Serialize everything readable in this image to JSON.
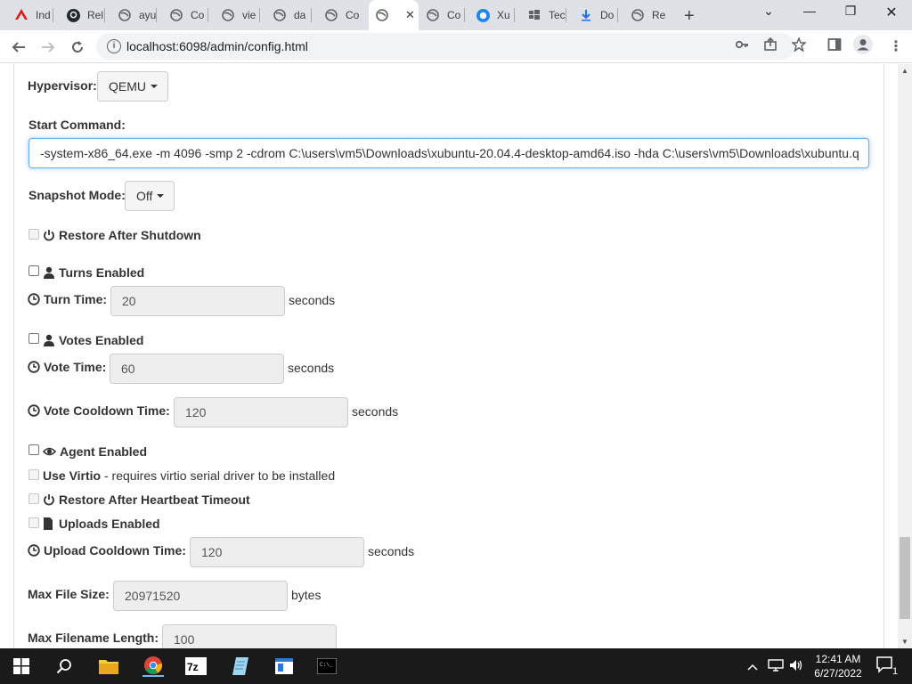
{
  "browser": {
    "tabs": [
      {
        "label": "Ind",
        "icon": "angular-icon"
      },
      {
        "label": "Rel",
        "icon": "github-icon"
      },
      {
        "label": "ayu",
        "icon": "globe-icon"
      },
      {
        "label": "Co",
        "icon": "globe-icon"
      },
      {
        "label": "vie",
        "icon": "globe-icon"
      },
      {
        "label": "da",
        "icon": "globe-icon"
      },
      {
        "label": "Co",
        "icon": "globe-icon"
      },
      {
        "label": "",
        "icon": "globe-icon",
        "active": true
      },
      {
        "label": "Co",
        "icon": "globe-icon"
      },
      {
        "label": "Xu",
        "icon": "xubuntu-icon"
      },
      {
        "label": "Tec",
        "icon": "windows-flag-icon"
      },
      {
        "label": "Do",
        "icon": "download-icon"
      },
      {
        "label": "Re",
        "icon": "globe-icon"
      }
    ],
    "url": "localhost:6098/admin/config.html"
  },
  "config": {
    "hypervisor_label": "Hypervisor:",
    "hypervisor_value": "QEMU",
    "start_command_label": "Start Command:",
    "start_command_value": "-system-x86_64.exe -m 4096 -smp 2 -cdrom C:\\users\\vm5\\Downloads\\xubuntu-20.04.4-desktop-amd64.iso -hda C:\\users\\vm5\\Downloads\\xubuntu.q",
    "snapshot_label": "Snapshot Mode:",
    "snapshot_value": "Off",
    "restore_after_shutdown": "Restore After Shutdown",
    "turns_enabled": "Turns Enabled",
    "turn_time_label": "Turn Time:",
    "turn_time_value": "20",
    "votes_enabled": "Votes Enabled",
    "vote_time_label": "Vote Time:",
    "vote_time_value": "60",
    "vote_cooldown_label": "Vote Cooldown Time:",
    "vote_cooldown_value": "120",
    "agent_enabled": "Agent Enabled",
    "use_virtio": "Use Virtio",
    "use_virtio_note": " - requires virtio serial driver to be installed",
    "restore_after_heartbeat": "Restore After Heartbeat Timeout",
    "uploads_enabled": "Uploads Enabled",
    "upload_cooldown_label": "Upload Cooldown Time:",
    "upload_cooldown_value": "120",
    "max_file_size_label": "Max File Size:",
    "max_file_size_value": "20971520",
    "max_filename_label": "Max Filename Length:",
    "max_filename_value": "100",
    "unit_seconds": "seconds",
    "unit_bytes": "bytes"
  },
  "taskbar": {
    "time": "12:41 AM",
    "date": "6/27/2022",
    "notification_count": "1"
  }
}
